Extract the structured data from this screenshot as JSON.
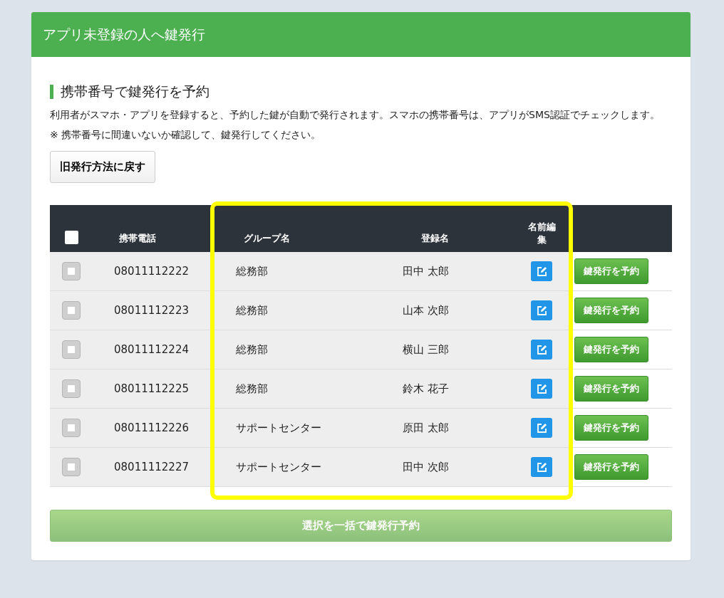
{
  "header": {
    "title": "アプリ未登録の人へ鍵発行"
  },
  "section": {
    "title": "携帯番号で鍵発行を予約",
    "description": "利用者がスマホ・アプリを登録すると、予約した鍵が自動で発行されます。スマホの携帯番号は、アプリがSMS認証でチェックします。",
    "note": "※ 携帯番号に間違いないか確認して、鍵発行してください。",
    "back_button": "旧発行方法に戻す"
  },
  "table": {
    "select_all": {
      "checked": false
    },
    "columns": [
      {
        "label": "携帯電話",
        "highlighted": false
      },
      {
        "label": "グループ名",
        "highlighted": true
      },
      {
        "label": "登録名",
        "highlighted": true
      },
      {
        "label": "名前編集",
        "highlighted": true
      }
    ],
    "rows": [
      {
        "checked": false,
        "phone": "08011112222",
        "group": "総務部",
        "name": "田中 太郎",
        "action": "鍵発行を予約"
      },
      {
        "checked": false,
        "phone": "08011112223",
        "group": "総務部",
        "name": "山本 次郎",
        "action": "鍵発行を予約"
      },
      {
        "checked": false,
        "phone": "08011112224",
        "group": "総務部",
        "name": "横山 三郎",
        "action": "鍵発行を予約"
      },
      {
        "checked": false,
        "phone": "08011112225",
        "group": "総務部",
        "name": "鈴木 花子",
        "action": "鍵発行を予約"
      },
      {
        "checked": false,
        "phone": "08011112226",
        "group": "サポートセンター",
        "name": "原田 太郎",
        "action": "鍵発行を予約"
      },
      {
        "checked": false,
        "phone": "08011112227",
        "group": "サポートセンター",
        "name": "田中 次郎",
        "action": "鍵発行を予約"
      }
    ]
  },
  "bulk_button": {
    "label": "選択を一括で鍵発行予約",
    "disabled": true
  }
}
